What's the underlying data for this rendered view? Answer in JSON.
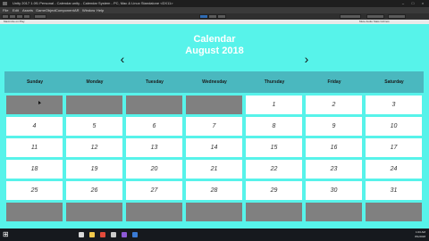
{
  "window": {
    "title": "Unity 2017 1.0f1 Personal - Calendar.unity - Calendar System - PC, Mac & Linux Standalone <DX11>"
  },
  "menu": [
    "File",
    "Edit",
    "Assets",
    "GameObject",
    "Component",
    "AR",
    "Window",
    "Help"
  ],
  "status": {
    "left": "Maximize on Play",
    "right": "Mute Audio   Stats   Gizmos"
  },
  "calendar": {
    "title": "Calendar",
    "month_year": "August 2018",
    "prev_icon": "‹",
    "next_icon": "›",
    "weekdays": [
      "Sunday",
      "Monday",
      "Tuesday",
      "Wednesday",
      "Thursday",
      "Friday",
      "Saturday"
    ],
    "weeks": [
      [
        "",
        "",
        "",
        "",
        "1",
        "2",
        "3"
      ],
      [
        "4",
        "5",
        "6",
        "7",
        "8",
        "9",
        "10"
      ],
      [
        "11",
        "12",
        "13",
        "14",
        "15",
        "16",
        "17"
      ],
      [
        "18",
        "19",
        "20",
        "21",
        "22",
        "23",
        "24"
      ],
      [
        "25",
        "26",
        "27",
        "28",
        "29",
        "30",
        "31"
      ],
      [
        "",
        "",
        "",
        "",
        "",
        "",
        ""
      ]
    ],
    "colors": {
      "background": "#57f3ea",
      "header_row": "#4ab8bf",
      "empty_cell": "#808080",
      "day_cell": "#ffffff"
    }
  },
  "taskbar": {
    "time": "1:03 AM",
    "date": "8/1/2018"
  }
}
